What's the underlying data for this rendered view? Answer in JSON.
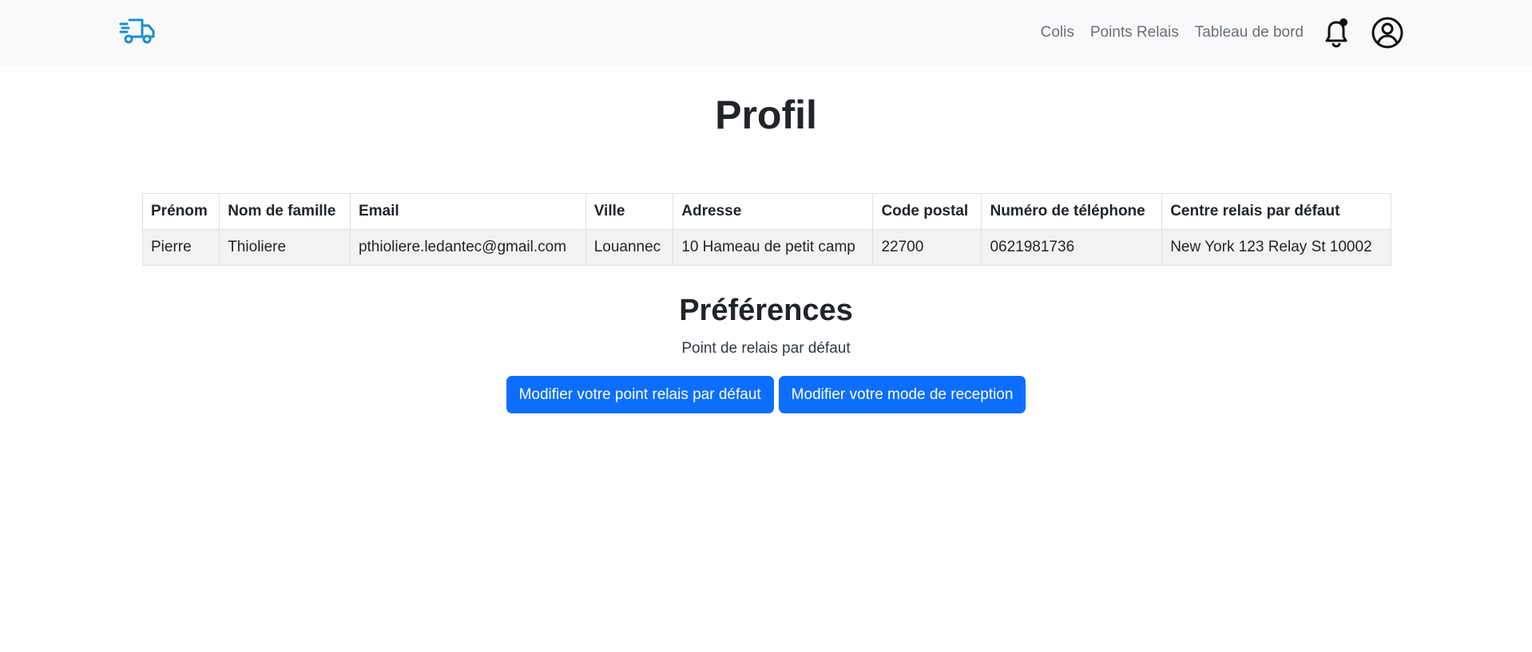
{
  "nav": {
    "links": [
      "Colis",
      "Points Relais",
      "Tableau de bord"
    ],
    "icons": {
      "logo": "delivery-truck-icon",
      "notifications": "bell-icon",
      "profile": "user-circle-icon"
    },
    "logo_color": "#1a8fc9"
  },
  "page": {
    "title": "Profil"
  },
  "profile_table": {
    "headers": [
      "Prénom",
      "Nom de famille",
      "Email",
      "Ville",
      "Adresse",
      "Code postal",
      "Numéro de téléphone",
      "Centre relais par défaut"
    ],
    "row": [
      "Pierre",
      "Thioliere",
      "pthioliere.ledantec@gmail.com",
      "Louannec",
      "10 Hameau de petit camp",
      "22700",
      "0621981736",
      "New York 123 Relay St 10002"
    ]
  },
  "preferences": {
    "title": "Préférences",
    "subtitle": "Point de relais par défaut",
    "buttons": [
      "Modifier votre point relais par défaut",
      "Modifier votre mode de reception"
    ],
    "button_color": "#0d6efd"
  }
}
